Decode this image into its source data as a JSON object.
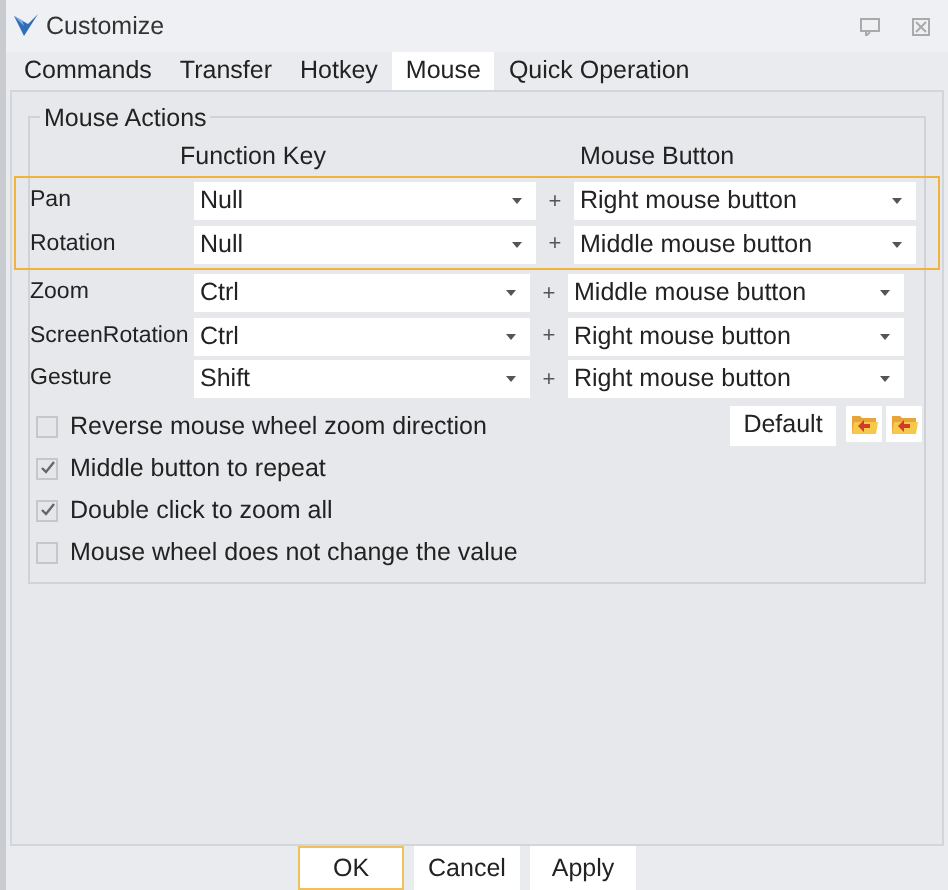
{
  "window": {
    "title": "Customize"
  },
  "tabs": [
    {
      "label": "Commands",
      "selected": false
    },
    {
      "label": "Transfer",
      "selected": false
    },
    {
      "label": "Hotkey",
      "selected": false
    },
    {
      "label": "Mouse",
      "selected": true
    },
    {
      "label": "Quick Operation",
      "selected": false
    }
  ],
  "group": {
    "title": "Mouse Actions",
    "columns": [
      "Function Key",
      "Mouse Button"
    ],
    "rows": [
      {
        "label": "Pan",
        "function_key": "Null",
        "plus": "+",
        "mouse_button": "Right mouse button",
        "highlighted": true
      },
      {
        "label": "Rotation",
        "function_key": "Null",
        "plus": "+",
        "mouse_button": "Middle mouse button",
        "highlighted": true
      },
      {
        "label": "Zoom",
        "function_key": "Ctrl",
        "plus": "+",
        "mouse_button": "Middle mouse button",
        "highlighted": false
      },
      {
        "label": "ScreenRotation",
        "function_key": "Ctrl",
        "plus": "+",
        "mouse_button": "Right mouse button",
        "highlighted": false
      },
      {
        "label": "Gesture",
        "function_key": "Shift",
        "plus": "+",
        "mouse_button": "Right mouse button",
        "highlighted": false
      }
    ],
    "options": [
      {
        "label": "Reverse mouse wheel zoom direction",
        "checked": false
      },
      {
        "label": "Middle button to repeat",
        "checked": true
      },
      {
        "label": "Double click to zoom all",
        "checked": true
      },
      {
        "label": "Mouse wheel does not change the value",
        "checked": false
      }
    ],
    "default_button": "Default"
  },
  "buttons": [
    {
      "label": "OK",
      "default": true
    },
    {
      "label": "Cancel",
      "default": false
    },
    {
      "label": "Apply",
      "default": false
    }
  ]
}
